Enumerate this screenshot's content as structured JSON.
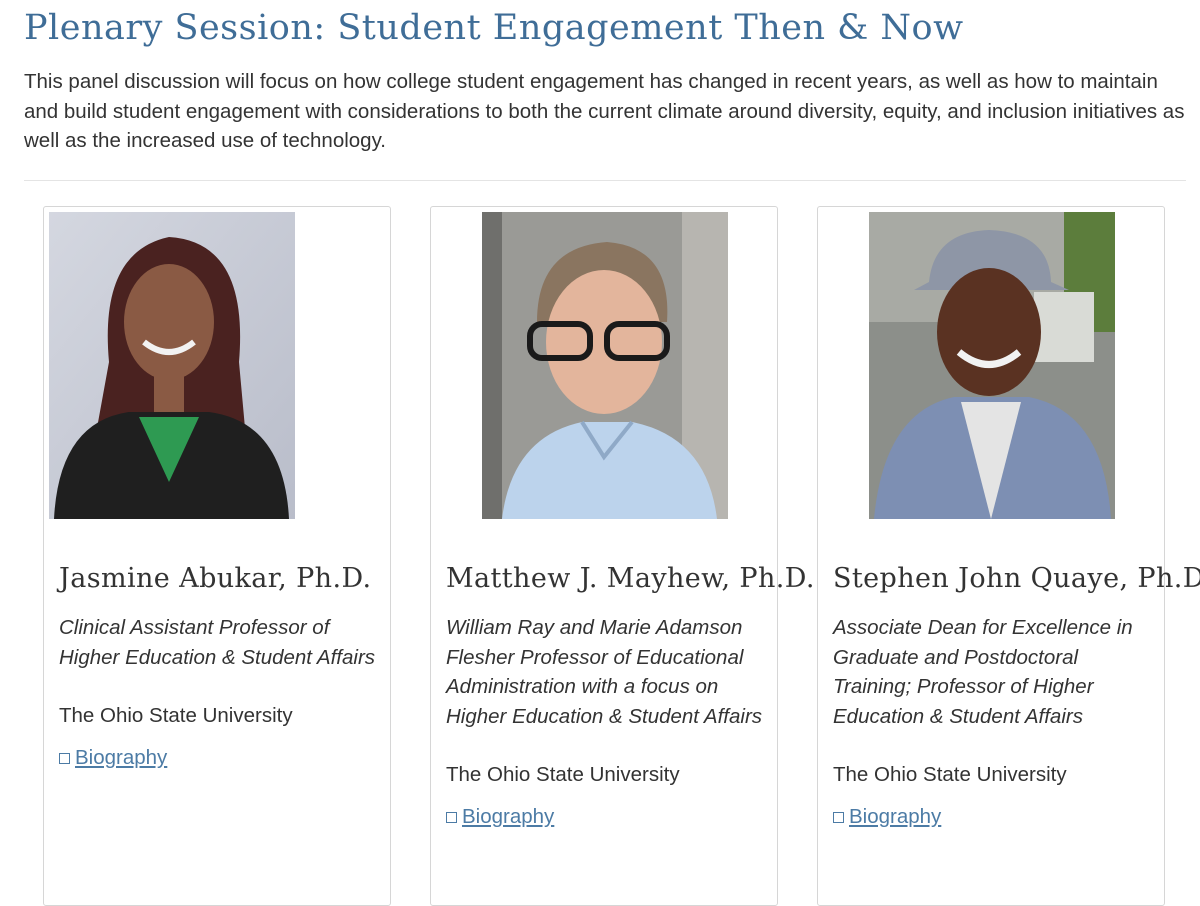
{
  "page": {
    "title": "Plenary Session: Student Engagement Then & Now",
    "intro": "This panel discussion will focus on how college student engagement has changed in recent years, as well as how to maintain and build student engagement with considerations to both the current climate around diversity, equity, and inclusion initiatives as well as the increased use of technology."
  },
  "panelists": [
    {
      "name": "Jasmine Abukar, Ph.D.",
      "title": "Clinical Assistant Professor of Higher Education & Student Affairs",
      "org": "The Ohio State University",
      "link_label": "Biography"
    },
    {
      "name": "Matthew J. Mayhew, Ph.D.",
      "title": "William Ray and Marie Adamson Flesher Professor of Educational Administration with a focus on Higher Education & Student Affairs",
      "org": "The Ohio State University",
      "link_label": "Biography"
    },
    {
      "name": "Stephen John Quaye, Ph.D.",
      "title": "Associate Dean for Excellence in Graduate and Postdoctoral Training; Professor of Higher Education & Student Affairs",
      "org": "The Ohio State University",
      "link_label": "Biography"
    }
  ],
  "colors": {
    "heading": "#3f6d97",
    "link": "#4c7ba5",
    "text": "#333333",
    "border": "#d6d6d6"
  },
  "icons": {
    "link_icon": "external-box-icon"
  }
}
